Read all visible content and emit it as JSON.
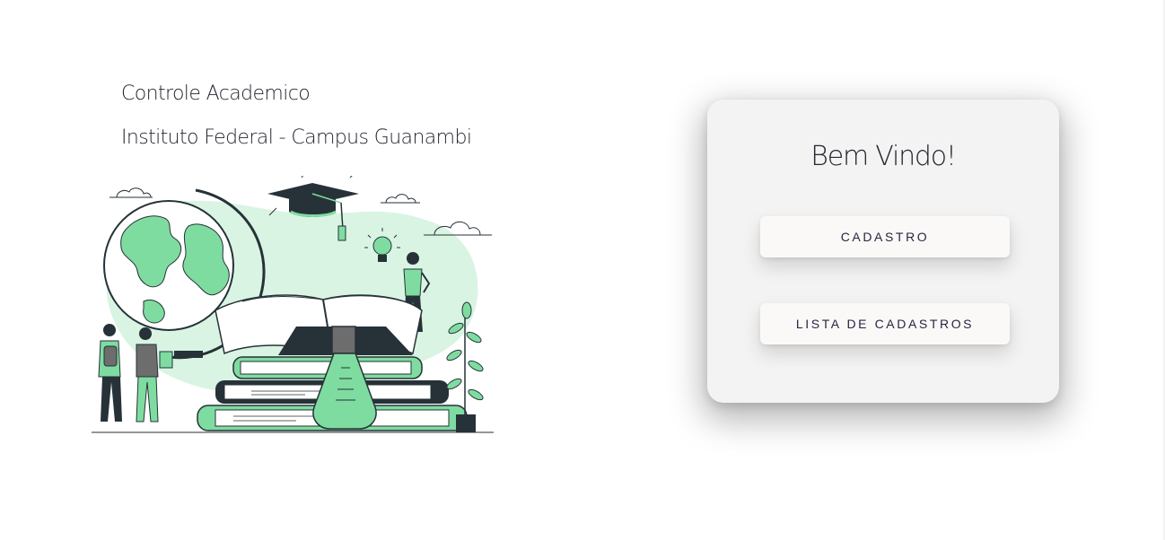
{
  "header": {
    "app_title": "Controle Academico",
    "institution": "Instituto Federal - Campus Guanambi"
  },
  "illustration": {
    "icon": "education-illustration",
    "accent_color": "#7fdca0",
    "light_accent_color": "#d9f4e3",
    "dark_color": "#263238"
  },
  "card": {
    "greeting": "Bem Vindo!",
    "buttons": [
      {
        "label": "CADASTRO"
      },
      {
        "label": "LISTA DE CADASTROS"
      }
    ]
  }
}
